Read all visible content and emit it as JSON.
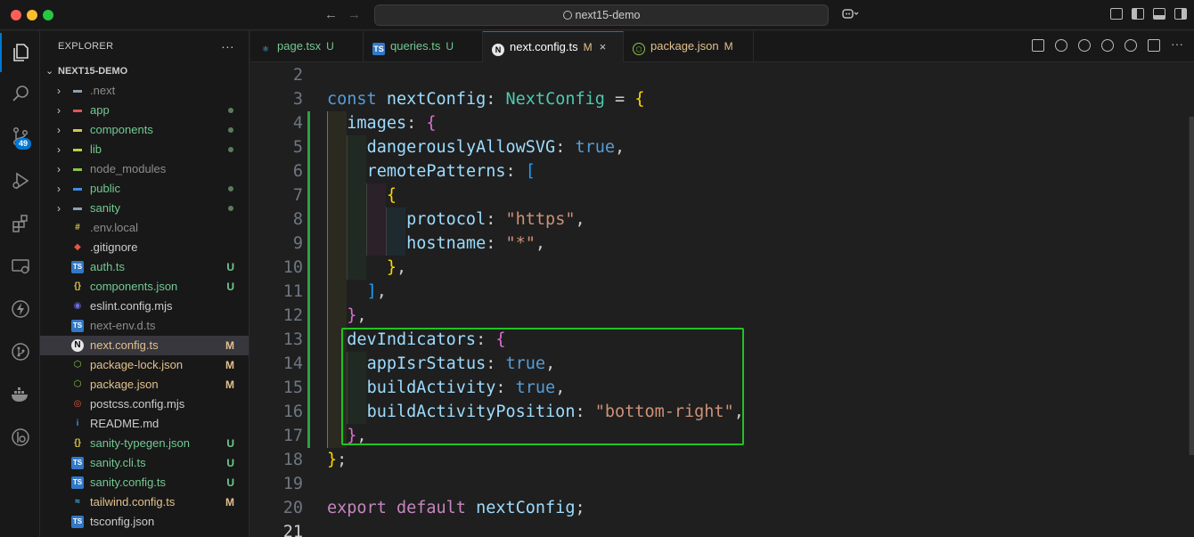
{
  "window": {
    "search_text": "next15-demo"
  },
  "activity_bar": {
    "source_control_badge": "49"
  },
  "explorer": {
    "title": "EXPLORER",
    "more": "···",
    "root": "NEXT15-DEMO",
    "items": [
      {
        "name": ".next",
        "icon": "folder-icon",
        "type": "folder",
        "status": "",
        "color": "gray"
      },
      {
        "name": "app",
        "icon": "folder-app-icon",
        "type": "folder",
        "status": "dot",
        "color": "green"
      },
      {
        "name": "components",
        "icon": "folder-components-icon",
        "type": "folder",
        "status": "dot",
        "color": "green"
      },
      {
        "name": "lib",
        "icon": "folder-lib-icon",
        "type": "folder",
        "status": "dot",
        "color": "green"
      },
      {
        "name": "node_modules",
        "icon": "folder-node-icon",
        "type": "folder",
        "status": "",
        "color": "gray"
      },
      {
        "name": "public",
        "icon": "folder-public-icon",
        "type": "folder",
        "status": "dot",
        "color": "green"
      },
      {
        "name": "sanity",
        "icon": "folder-icon",
        "type": "folder",
        "status": "dot",
        "color": "green"
      },
      {
        "name": ".env.local",
        "icon": "env-icon",
        "type": "file",
        "status": "",
        "color": "gray"
      },
      {
        "name": ".gitignore",
        "icon": "git-icon",
        "type": "file",
        "status": "",
        "color": "white"
      },
      {
        "name": "auth.ts",
        "icon": "ts-icon",
        "type": "file",
        "status": "U",
        "color": "green"
      },
      {
        "name": "components.json",
        "icon": "json-icon",
        "type": "file",
        "status": "U",
        "color": "green"
      },
      {
        "name": "eslint.config.mjs",
        "icon": "eslint-icon",
        "type": "file",
        "status": "",
        "color": "white"
      },
      {
        "name": "next-env.d.ts",
        "icon": "ts-icon",
        "type": "file",
        "status": "",
        "color": "gray"
      },
      {
        "name": "next.config.ts",
        "icon": "next-icon",
        "type": "file",
        "status": "M",
        "color": "yellow"
      },
      {
        "name": "package-lock.json",
        "icon": "npm-icon",
        "type": "file",
        "status": "M",
        "color": "yellow"
      },
      {
        "name": "package.json",
        "icon": "npm-icon",
        "type": "file",
        "status": "M",
        "color": "yellow"
      },
      {
        "name": "postcss.config.mjs",
        "icon": "postcss-icon",
        "type": "file",
        "status": "",
        "color": "white"
      },
      {
        "name": "README.md",
        "icon": "info-icon",
        "type": "file",
        "status": "",
        "color": "white"
      },
      {
        "name": "sanity-typegen.json",
        "icon": "json-icon",
        "type": "file",
        "status": "U",
        "color": "green"
      },
      {
        "name": "sanity.cli.ts",
        "icon": "ts-icon",
        "type": "file",
        "status": "U",
        "color": "green"
      },
      {
        "name": "sanity.config.ts",
        "icon": "ts-icon",
        "type": "file",
        "status": "U",
        "color": "green"
      },
      {
        "name": "tailwind.config.ts",
        "icon": "tailwind-icon",
        "type": "file",
        "status": "M",
        "color": "yellow"
      },
      {
        "name": "tsconfig.json",
        "icon": "ts-icon",
        "type": "file",
        "status": "",
        "color": "white"
      }
    ]
  },
  "tabs": [
    {
      "label": "page.tsx",
      "deco": "U",
      "icon": "react-icon"
    },
    {
      "label": "queries.ts",
      "deco": "U",
      "icon": "ts-icon"
    },
    {
      "label": "next.config.ts",
      "deco": "M",
      "icon": "next-icon",
      "active": true,
      "close": "×"
    },
    {
      "label": "package.json",
      "deco": "M",
      "icon": "npm-icon"
    }
  ],
  "editor": {
    "current_line": "21",
    "lines": [
      {
        "n": "2",
        "code": ""
      },
      {
        "n": "3",
        "code": "const nextConfig: NextConfig = {"
      },
      {
        "n": "4",
        "code": "  images: {"
      },
      {
        "n": "5",
        "code": "    dangerouslyAllowSVG: true,"
      },
      {
        "n": "6",
        "code": "    remotePatterns: ["
      },
      {
        "n": "7",
        "code": "      {"
      },
      {
        "n": "8",
        "code": "        protocol: \"https\","
      },
      {
        "n": "9",
        "code": "        hostname: \"*\","
      },
      {
        "n": "10",
        "code": "      },"
      },
      {
        "n": "11",
        "code": "    ],"
      },
      {
        "n": "12",
        "code": "  },"
      },
      {
        "n": "13",
        "code": "  devIndicators: {"
      },
      {
        "n": "14",
        "code": "    appIsrStatus: true,"
      },
      {
        "n": "15",
        "code": "    buildActivity: true,"
      },
      {
        "n": "16",
        "code": "    buildActivityPosition: \"bottom-right\","
      },
      {
        "n": "17",
        "code": "  },"
      },
      {
        "n": "18",
        "code": "};"
      },
      {
        "n": "19",
        "code": ""
      },
      {
        "n": "20",
        "code": "export default nextConfig;"
      },
      {
        "n": "21",
        "code": ""
      }
    ],
    "tokens": {
      "const": "const",
      "nextConfig": "nextConfig",
      "colon": ":",
      "NextConfig": "NextConfig",
      "eq": "=",
      "open": "{",
      "images": "images",
      "dangerouslyAllowSVG": "dangerouslyAllowSVG",
      "true": "true",
      "comma": ",",
      "remotePatterns": "remotePatterns",
      "lbrack": "[",
      "rbrack": "]",
      "protocol": "protocol",
      "https": "\"https\"",
      "hostname": "hostname",
      "star": "\"*\"",
      "close": "}",
      "devIndicators": "devIndicators",
      "appIsrStatus": "appIsrStatus",
      "buildActivity": "buildActivity",
      "buildActivityPosition": "buildActivityPosition",
      "bottomRight": "\"bottom-right\"",
      "semi": ";",
      "export": "export",
      "default": "default"
    },
    "highlight_color": "#22c322"
  },
  "colors": {
    "accent": "#0078d4",
    "untracked": "#73c991",
    "modified": "#e2c08d"
  }
}
